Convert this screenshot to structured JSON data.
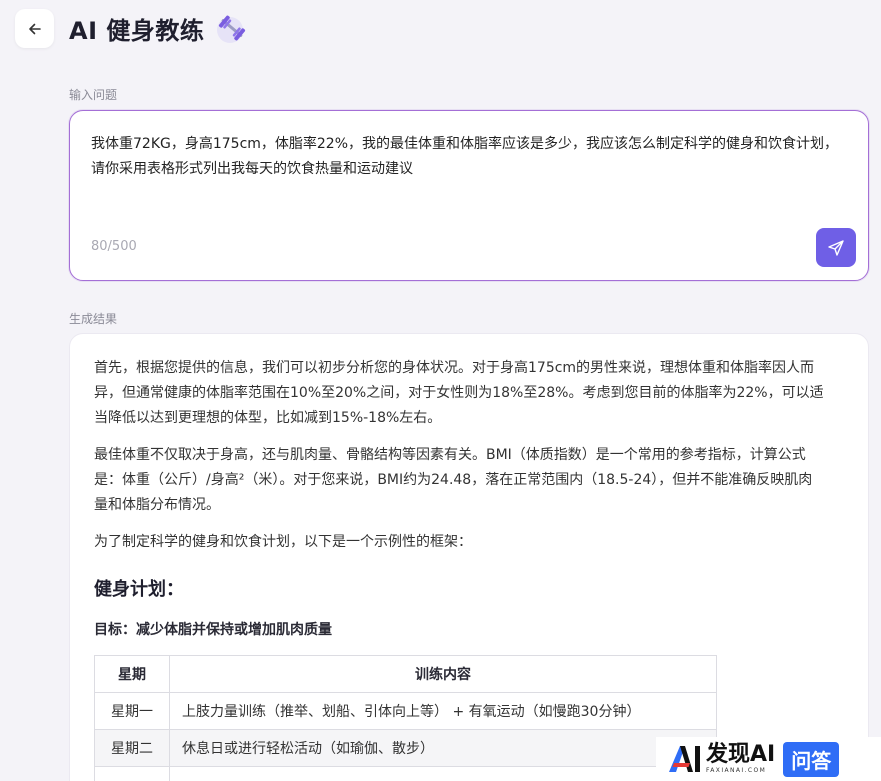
{
  "header": {
    "title": "AI 健身教练",
    "back_icon": "arrow-left-icon",
    "title_icon": "dumbbell-icon"
  },
  "input_section": {
    "label": "输入问题",
    "text": "我体重72KG，身高175cm，体脂率22%，我的最佳体重和体脂率应该是多少，我应该怎么制定科学的健身和饮食计划，请你采用表格形式列出我每天的饮食热量和运动建议",
    "char_count": "80/500",
    "send_icon": "send-icon"
  },
  "result_section": {
    "label": "生成结果",
    "paragraphs": [
      "首先，根据您提供的信息，我们可以初步分析您的身体状况。对于身高175cm的男性来说，理想体重和体脂率因人而异，但通常健康的体脂率范围在10%至20%之间，对于女性则为18%至28%。考虑到您目前的体脂率为22%，可以适当降低以达到更理想的体型，比如减到15%-18%左右。",
      "最佳体重不仅取决于身高，还与肌肉量、骨骼结构等因素有关。BMI（体质指数）是一个常用的参考指标，计算公式是：体重（公斤）/身高²（米）。对于您来说，BMI约为24.48，落在正常范围内（18.5-24），但并不能准确反映肌肉量和体脂分布情况。",
      "为了制定科学的健身和饮食计划，以下是一个示例性的框架："
    ],
    "plan_heading": "健身计划：",
    "goal_heading": "目标：减少体脂并保持或增加肌肉质量",
    "table": {
      "headers": [
        "星期",
        "训练内容"
      ],
      "rows": [
        [
          "星期一",
          "上肢力量训练（推举、划船、引体向上等） + 有氧运动（如慢跑30分钟）"
        ],
        [
          "星期二",
          "休息日或进行轻松活动（如瑜伽、散步）"
        ]
      ]
    }
  },
  "watermark": {
    "brand": "发现AI",
    "sub": "FAXIANAI.COM",
    "badge": "问答"
  },
  "colors": {
    "accent": "#6f5fe6",
    "input_border": "#a46fd6",
    "background": "#f4f3f8"
  }
}
